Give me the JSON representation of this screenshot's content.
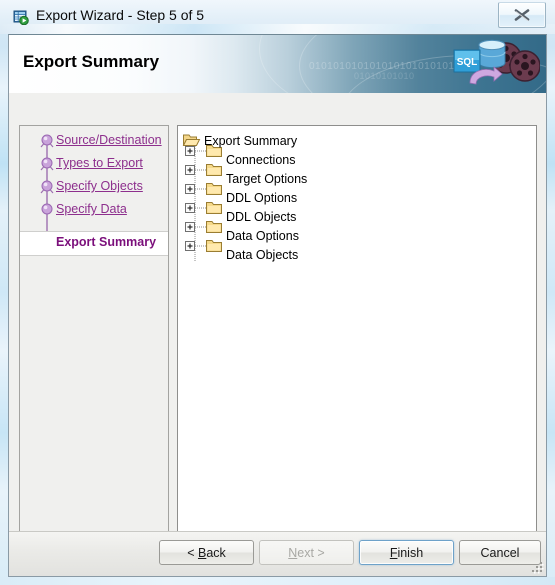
{
  "window": {
    "title": "Export Wizard - Step 5 of 5",
    "icon": "export-table-icon",
    "close_glyph": "✕"
  },
  "banner": {
    "title": "Export Summary",
    "binary_line_1": "010101010101010101010101010",
    "binary_line_2": "01010101010",
    "art_label": "SQL",
    "gradient_from": "#ffffff",
    "gradient_to": "#336a88"
  },
  "sidebar": {
    "steps": [
      {
        "label": "Source/Destination",
        "state": "visited"
      },
      {
        "label": "Types to Export",
        "state": "visited"
      },
      {
        "label": "Specify Objects",
        "state": "visited"
      },
      {
        "label": "Specify Data",
        "state": "visited"
      },
      {
        "label": "Export Summary",
        "state": "current"
      }
    ],
    "link_color": "#8d2f8d",
    "current_color": "#7b0f7b"
  },
  "tree": {
    "root": {
      "label": "Export Summary",
      "icon": "folder-open-icon",
      "expanded": true
    },
    "nodes": [
      {
        "label": "Connections",
        "icon": "folder-icon",
        "expander": "+",
        "expanded": false
      },
      {
        "label": "Target Options",
        "icon": "folder-icon",
        "expander": "+",
        "expanded": false
      },
      {
        "label": "DDL Options",
        "icon": "folder-icon",
        "expander": "+",
        "expanded": false
      },
      {
        "label": "DDL Objects",
        "icon": "folder-icon",
        "expander": "+",
        "expanded": false
      },
      {
        "label": "Data Options",
        "icon": "folder-icon",
        "expander": "+",
        "expanded": false
      },
      {
        "label": "Data Objects",
        "icon": "folder-icon",
        "expander": "+",
        "expanded": false
      }
    ]
  },
  "buttons": {
    "back": {
      "label": "< Back",
      "mnemonic": "B",
      "enabled": true,
      "default": false
    },
    "next": {
      "label": "Next >",
      "mnemonic": "N",
      "enabled": false,
      "default": false
    },
    "finish": {
      "label": "Finish",
      "mnemonic": "F",
      "enabled": true,
      "default": true
    },
    "cancel": {
      "label": "Cancel",
      "mnemonic": "",
      "enabled": true,
      "default": false
    }
  }
}
